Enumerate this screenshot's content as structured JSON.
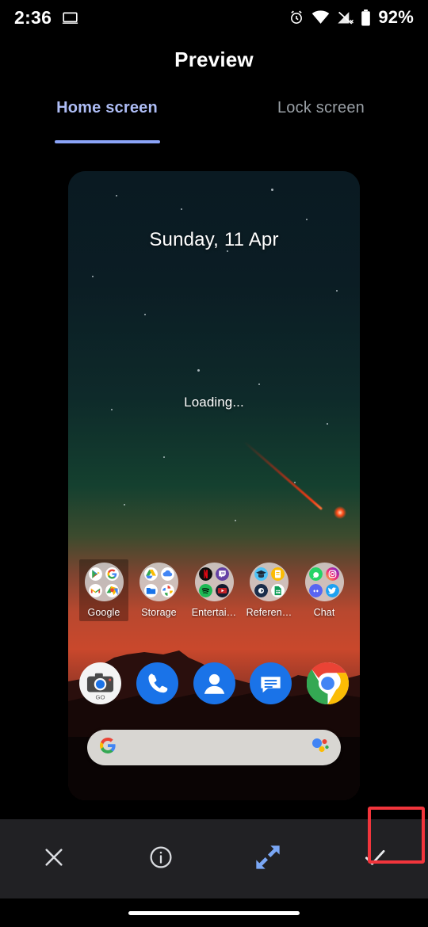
{
  "statusbar": {
    "time": "2:36",
    "battery_percent": "92%",
    "icons": [
      "cast-screen-icon",
      "alarm-icon",
      "wifi-icon",
      "no-sim-icon",
      "battery-icon"
    ]
  },
  "header": {
    "title": "Preview"
  },
  "tabs": [
    {
      "label": "Home screen",
      "active": true
    },
    {
      "label": "Lock screen",
      "active": false
    }
  ],
  "preview": {
    "date": "Sunday, 11 Apr",
    "loading": "Loading...",
    "wallpaper_description": "night sky with red meteor over sunset mountains",
    "folders": [
      {
        "label": "Google",
        "highlighted": true
      },
      {
        "label": "Storage",
        "highlighted": false
      },
      {
        "label": "Entertai…",
        "highlighted": false
      },
      {
        "label": "Referen…",
        "highlighted": false
      },
      {
        "label": "Chat",
        "highlighted": false
      }
    ],
    "dock": [
      {
        "name": "camera-go-app-icon"
      },
      {
        "name": "phone-app-icon"
      },
      {
        "name": "contacts-app-icon"
      },
      {
        "name": "messages-app-icon"
      },
      {
        "name": "chrome-app-icon"
      }
    ],
    "search_bar": {
      "leading_icon": "google-g-icon",
      "trailing_icon": "google-assistant-icon"
    }
  },
  "toolbar": {
    "close_label": "close-icon",
    "info_label": "info-icon",
    "expand_label": "expand-icon",
    "confirm_label": "check-icon",
    "highlighted_button": "confirm-button",
    "highlight_color": "#f2353c"
  },
  "colors": {
    "background": "#000000",
    "toolbar_bg": "#212124",
    "tab_active": "#aebdf5",
    "tab_inactive": "#9aa0a6",
    "accent": "#8ba4f9",
    "highlight": "#f2353c"
  }
}
